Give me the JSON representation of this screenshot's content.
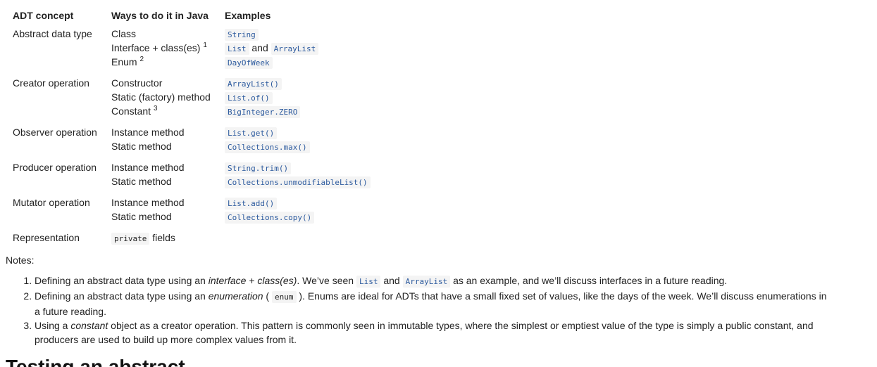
{
  "table": {
    "headers": [
      "ADT concept",
      "Ways to do it in Java",
      "Examples"
    ],
    "rows": [
      {
        "concept": "Abstract data type",
        "ways": [
          {
            "text": "Class",
            "sup": ""
          },
          {
            "text": "Interface + class(es)",
            "sup": "1"
          },
          {
            "text": "Enum",
            "sup": "2"
          }
        ],
        "examples": [
          {
            "code": "String"
          },
          {
            "code1": "List",
            "and": "and",
            "code2": "ArrayList"
          },
          {
            "code": "DayOfWeek"
          }
        ]
      },
      {
        "concept": "Creator operation",
        "ways": [
          {
            "text": "Constructor",
            "sup": ""
          },
          {
            "text": "Static (factory) method",
            "sup": ""
          },
          {
            "text": "Constant",
            "sup": "3"
          }
        ],
        "examples": [
          {
            "code": "ArrayList()"
          },
          {
            "code": "List.of()"
          },
          {
            "code": "BigInteger.ZERO"
          }
        ]
      },
      {
        "concept": "Observer operation",
        "ways": [
          {
            "text": "Instance method"
          },
          {
            "text": "Static method"
          }
        ],
        "examples": [
          {
            "code": "List.get()"
          },
          {
            "code": "Collections.max()"
          }
        ]
      },
      {
        "concept": "Producer operation",
        "ways": [
          {
            "text": "Instance method"
          },
          {
            "text": "Static method"
          }
        ],
        "examples": [
          {
            "code": "String.trim()"
          },
          {
            "code": "Collections.unmodifiableList()"
          }
        ]
      },
      {
        "concept": "Mutator operation",
        "ways": [
          {
            "text": "Instance method"
          },
          {
            "text": "Static method"
          }
        ],
        "examples": [
          {
            "code": "List.add()"
          },
          {
            "code": "Collections.copy()"
          }
        ]
      },
      {
        "concept": "Representation",
        "ways_code": "private",
        "ways_text": "fields"
      }
    ]
  },
  "notes": {
    "label": "Notes:",
    "items": [
      {
        "p1": "Defining an abstract data type using an ",
        "em": "interface + class(es)",
        "p2": ". We’ve seen ",
        "code1": "List",
        "p3": " and ",
        "code2": "ArrayList",
        "p4": " as an example, and we’ll discuss interfaces in a future reading."
      },
      {
        "p1": "Defining an abstract data type using an ",
        "em": "enumeration",
        "p2": " ( ",
        "code": "enum",
        "p3": " ). Enums are ideal for ADTs that have a small fixed set of values, like the days of the week. We’ll discuss enumerations in a future reading."
      },
      {
        "p1": "Using a ",
        "em": "constant",
        "p2": " object as a creator operation. This pattern is commonly seen in immutable types, where the simplest or emptiest value of the type is simply a public constant, and producers are used to build up more complex values from it."
      }
    ]
  },
  "next_heading": "Testing an abstract"
}
